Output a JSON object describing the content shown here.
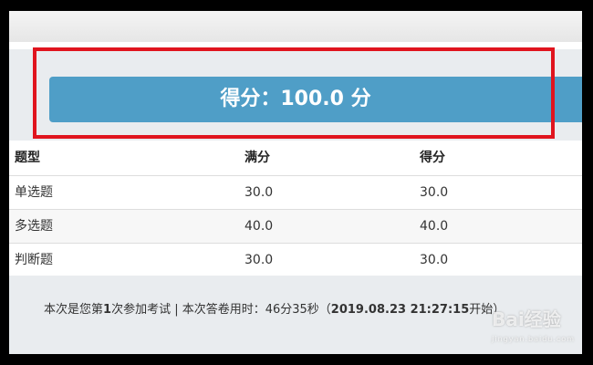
{
  "score_banner": {
    "text": "得分：100.0 分"
  },
  "table": {
    "headers": [
      "题型",
      "满分",
      "得分"
    ],
    "rows": [
      [
        "单选题",
        "30.0",
        "30.0"
      ],
      [
        "多选题",
        "40.0",
        "40.0"
      ],
      [
        "判断题",
        "30.0",
        "30.0"
      ]
    ]
  },
  "footer": {
    "prefix": "本次是您第",
    "attempt": "1",
    "middle": "次参加考试 | 本次答卷用时：46分35秒（",
    "start_time": "2019.08.23 21:27:15",
    "suffix": "开始）"
  },
  "watermark": {
    "text": "Bai经验",
    "sub": "jingyan.baidu.com"
  },
  "colors": {
    "banner": "#4f9ec7",
    "highlight": "#e0141e"
  }
}
